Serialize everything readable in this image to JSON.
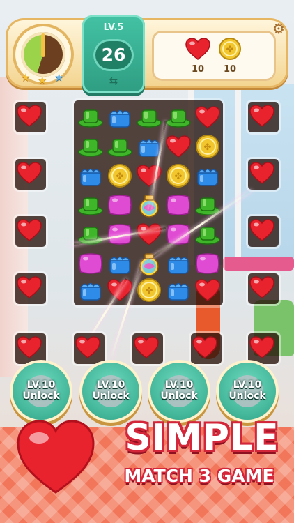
{
  "hud": {
    "level_label": "LV.5",
    "moves": "26",
    "goals": [
      {
        "icon": "heart-icon",
        "count": "10"
      },
      {
        "icon": "coin-icon",
        "count": "10"
      }
    ],
    "stars_filled": 2,
    "stars_total": 3
  },
  "board": {
    "rows": [
      [
        "hat",
        "cake",
        "hat",
        "hat",
        "heart"
      ],
      [
        "hat",
        "hat",
        "cake",
        "heart",
        "coin"
      ],
      [
        "cake",
        "coin",
        "heart",
        "coin",
        "cake"
      ],
      [
        "hat",
        "pillow",
        "potion",
        "pillow",
        "hat"
      ],
      [
        "hat",
        "pillow",
        "heart",
        "pillow",
        "hat"
      ],
      [
        "pillow",
        "cake",
        "potion",
        "cake",
        "pillow"
      ],
      [
        "cake",
        "heart",
        "coin",
        "cake",
        "heart"
      ]
    ]
  },
  "unlock_buttons": [
    {
      "line1": "LV.10",
      "line2": "Unlock",
      "tool": "glove-icon"
    },
    {
      "line1": "LV.10",
      "line2": "Unlock",
      "tool": "hand-icon"
    },
    {
      "line1": "LV.10",
      "line2": "Unlock",
      "tool": "hammer-icon"
    },
    {
      "line1": "LV.10",
      "line2": "Unlock",
      "tool": "roller-icon"
    }
  ],
  "banner": {
    "title": "SIMPLE",
    "subtitle": "MATCH 3 GAME"
  },
  "colors": {
    "heart": "#e8232e",
    "hat": "#3fb52a",
    "cake": "#2f8be8",
    "coin": "#f2c62d",
    "pillow": "#e04bd3",
    "panel_green": "#3bb497"
  }
}
